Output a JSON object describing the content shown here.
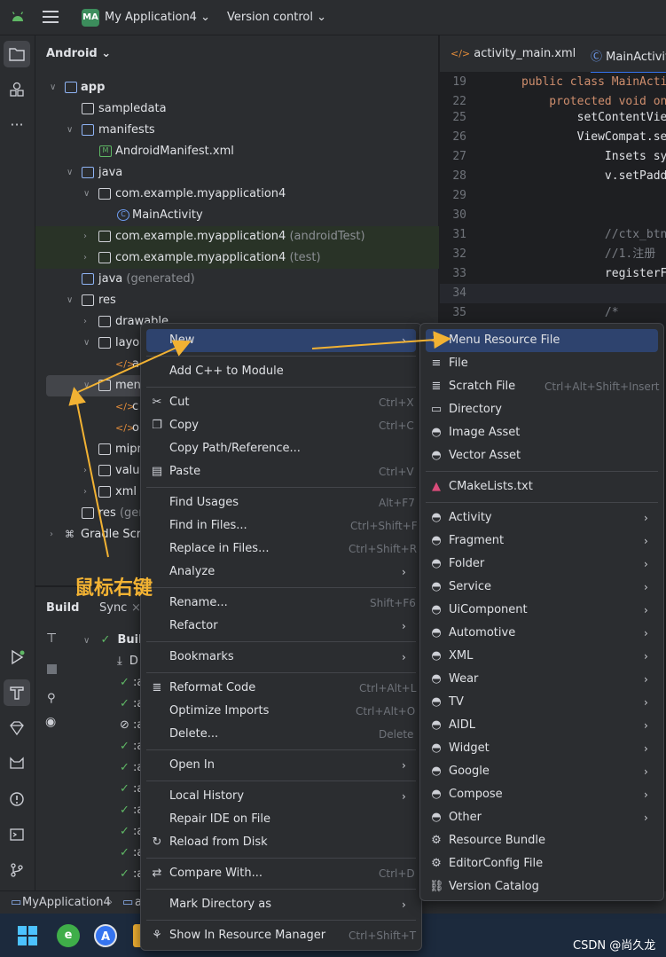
{
  "topbar": {
    "project_badge": "MA",
    "project_name": "My Application4",
    "version_control": "Version control"
  },
  "project_panel": {
    "title": "Android",
    "tree": [
      {
        "label": "app",
        "suffix": ""
      },
      {
        "label": "sampledata",
        "suffix": ""
      },
      {
        "label": "manifests",
        "suffix": ""
      },
      {
        "label": "AndroidManifest.xml",
        "suffix": ""
      },
      {
        "label": "java",
        "suffix": ""
      },
      {
        "label": "com.example.myapplication4",
        "suffix": ""
      },
      {
        "label": "MainActivity",
        "suffix": ""
      },
      {
        "label": "com.example.myapplication4",
        "suffix": "(androidTest)"
      },
      {
        "label": "com.example.myapplication4",
        "suffix": "(test)"
      },
      {
        "label": "java",
        "suffix": "(generated)"
      },
      {
        "label": "res",
        "suffix": ""
      },
      {
        "label": "drawable",
        "suffix": ""
      },
      {
        "label": "layou",
        "suffix": ""
      },
      {
        "label": "a",
        "suffix": ""
      },
      {
        "label": "menu",
        "suffix": ""
      },
      {
        "label": "c",
        "suffix": ""
      },
      {
        "label": "o",
        "suffix": ""
      },
      {
        "label": "mipn",
        "suffix": ""
      },
      {
        "label": "value",
        "suffix": ""
      },
      {
        "label": "xml",
        "suffix": ""
      },
      {
        "label": "res",
        "suffix": "(gen"
      },
      {
        "label": "Gradle Scri",
        "suffix": ""
      }
    ]
  },
  "build_panel": {
    "tab_build": "Build",
    "tab_sync": "Sync",
    "root_label": "Build",
    "child_d": "D",
    "rows": [
      ":a",
      ":a",
      ":a",
      ":a",
      ":a",
      ":a",
      ":a",
      ":a",
      ":a",
      ":a",
      ":a"
    ]
  },
  "editor": {
    "tabs": [
      "activity_main.xml",
      "MainActivity"
    ],
    "lines": [
      {
        "n": "19",
        "code": "public class MainActi"
      },
      {
        "n": "22",
        "code": "    protected void on"
      },
      {
        "n": "25",
        "code": "        setContentVie"
      },
      {
        "n": "26",
        "code": "        ViewCompat.se"
      },
      {
        "n": "27",
        "code": "            Insets sy"
      },
      {
        "n": "28",
        "code": "            v.setPadd"
      },
      {
        "n": "29",
        "code": ""
      },
      {
        "n": "30",
        "code": ""
      },
      {
        "n": "31",
        "code": "            //ctx_btn"
      },
      {
        "n": "32",
        "code": "            //1.注册"
      },
      {
        "n": "33",
        "code": "            registerF"
      },
      {
        "n": "34",
        "code": ""
      },
      {
        "n": "35",
        "code": "            /*"
      }
    ]
  },
  "context_menu": {
    "items": [
      {
        "label": "New",
        "shortcut": "",
        "icon": "",
        "arrow": true
      },
      {
        "label": "Add C++ to Module",
        "shortcut": "",
        "icon": "",
        "arrow": false
      },
      {
        "label": "Cut",
        "shortcut": "Ctrl+X",
        "icon": "scissors-icon",
        "arrow": false
      },
      {
        "label": "Copy",
        "shortcut": "Ctrl+C",
        "icon": "copy-icon",
        "arrow": false
      },
      {
        "label": "Copy Path/Reference...",
        "shortcut": "",
        "icon": "",
        "arrow": false
      },
      {
        "label": "Paste",
        "shortcut": "Ctrl+V",
        "icon": "paste-icon",
        "arrow": false
      },
      {
        "label": "Find Usages",
        "shortcut": "Alt+F7",
        "icon": "",
        "arrow": false
      },
      {
        "label": "Find in Files...",
        "shortcut": "Ctrl+Shift+F",
        "icon": "",
        "arrow": false
      },
      {
        "label": "Replace in Files...",
        "shortcut": "Ctrl+Shift+R",
        "icon": "",
        "arrow": false
      },
      {
        "label": "Analyze",
        "shortcut": "",
        "icon": "",
        "arrow": true
      },
      {
        "label": "Rename...",
        "shortcut": "Shift+F6",
        "icon": "",
        "arrow": false
      },
      {
        "label": "Refactor",
        "shortcut": "",
        "icon": "",
        "arrow": true
      },
      {
        "label": "Bookmarks",
        "shortcut": "",
        "icon": "",
        "arrow": true
      },
      {
        "label": "Reformat Code",
        "shortcut": "Ctrl+Alt+L",
        "icon": "reformat-icon",
        "arrow": false
      },
      {
        "label": "Optimize Imports",
        "shortcut": "Ctrl+Alt+O",
        "icon": "",
        "arrow": false
      },
      {
        "label": "Delete...",
        "shortcut": "Delete",
        "icon": "",
        "arrow": false
      },
      {
        "label": "Open In",
        "shortcut": "",
        "icon": "",
        "arrow": true
      },
      {
        "label": "Local History",
        "shortcut": "",
        "icon": "",
        "arrow": true
      },
      {
        "label": "Repair IDE on File",
        "shortcut": "",
        "icon": "",
        "arrow": false
      },
      {
        "label": "Reload from Disk",
        "shortcut": "",
        "icon": "reload-icon",
        "arrow": false
      },
      {
        "label": "Compare With...",
        "shortcut": "Ctrl+D",
        "icon": "compare-icon",
        "arrow": false
      },
      {
        "label": "Mark Directory as",
        "shortcut": "",
        "icon": "",
        "arrow": true
      },
      {
        "label": "Show In Resource Manager",
        "shortcut": "Ctrl+Shift+T",
        "icon": "resource-manager-icon",
        "arrow": false
      }
    ]
  },
  "new_submenu": {
    "items": [
      {
        "label": "Menu Resource File",
        "shortcut": "",
        "icon": "xml-icon",
        "arrow": false
      },
      {
        "label": "File",
        "shortcut": "",
        "icon": "file-icon",
        "arrow": false
      },
      {
        "label": "Scratch File",
        "shortcut": "Ctrl+Alt+Shift+Insert",
        "icon": "scratch-file-icon",
        "arrow": false
      },
      {
        "label": "Directory",
        "shortcut": "",
        "icon": "folder-icon",
        "arrow": false
      },
      {
        "label": "Image Asset",
        "shortcut": "",
        "icon": "android-icon",
        "arrow": false
      },
      {
        "label": "Vector Asset",
        "shortcut": "",
        "icon": "android-icon",
        "arrow": false
      },
      {
        "label": "CMakeLists.txt",
        "shortcut": "",
        "icon": "cmake-icon",
        "arrow": false
      },
      {
        "label": "Activity",
        "shortcut": "",
        "icon": "android-icon",
        "arrow": true
      },
      {
        "label": "Fragment",
        "shortcut": "",
        "icon": "android-icon",
        "arrow": true
      },
      {
        "label": "Folder",
        "shortcut": "",
        "icon": "android-icon",
        "arrow": true
      },
      {
        "label": "Service",
        "shortcut": "",
        "icon": "android-icon",
        "arrow": true
      },
      {
        "label": "UiComponent",
        "shortcut": "",
        "icon": "android-icon",
        "arrow": true
      },
      {
        "label": "Automotive",
        "shortcut": "",
        "icon": "android-icon",
        "arrow": true
      },
      {
        "label": "XML",
        "shortcut": "",
        "icon": "android-icon",
        "arrow": true
      },
      {
        "label": "Wear",
        "shortcut": "",
        "icon": "android-icon",
        "arrow": true
      },
      {
        "label": "TV",
        "shortcut": "",
        "icon": "android-icon",
        "arrow": true
      },
      {
        "label": "AIDL",
        "shortcut": "",
        "icon": "android-icon",
        "arrow": true
      },
      {
        "label": "Widget",
        "shortcut": "",
        "icon": "android-icon",
        "arrow": true
      },
      {
        "label": "Google",
        "shortcut": "",
        "icon": "android-icon",
        "arrow": true
      },
      {
        "label": "Compose",
        "shortcut": "",
        "icon": "android-icon",
        "arrow": true
      },
      {
        "label": "Other",
        "shortcut": "",
        "icon": "android-icon",
        "arrow": true
      },
      {
        "label": "Resource Bundle",
        "shortcut": "",
        "icon": "gear-icon",
        "arrow": false
      },
      {
        "label": "EditorConfig File",
        "shortcut": "",
        "icon": "gear-icon",
        "arrow": false
      },
      {
        "label": "Version Catalog",
        "shortcut": "",
        "icon": "catalog-icon",
        "arrow": false
      }
    ]
  },
  "statusbar": {
    "breadcrumb_project": "MyApplication4",
    "breadcrumb_next": "a"
  },
  "annotation": {
    "text": "鼠标右键"
  },
  "watermark": "CSDN @尚久龙",
  "colors": {
    "accent": "#3574f0",
    "highlight": "#2e436e",
    "annotation": "#f2b233",
    "android_green": "#5fb865"
  }
}
